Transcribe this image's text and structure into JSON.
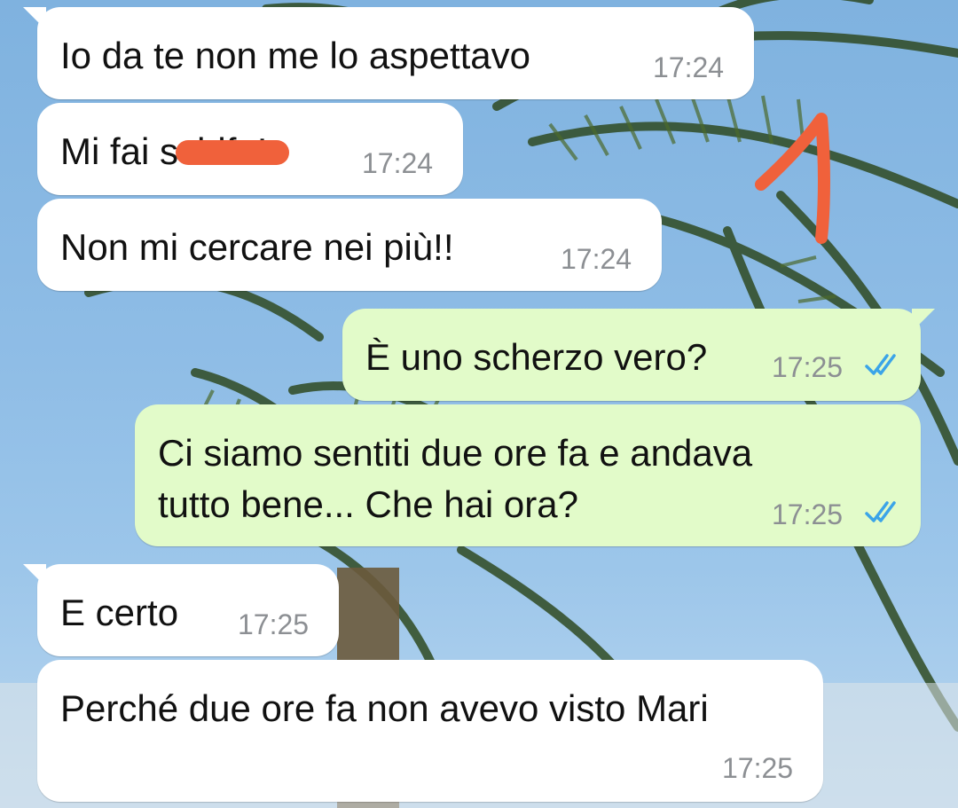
{
  "chat": {
    "messages": [
      {
        "direction": "incoming",
        "text": "Io da te non me lo aspettavo",
        "time": "17:24"
      },
      {
        "direction": "incoming",
        "text": "Mi fai schifo!",
        "time": "17:24",
        "redacted_word": "schifo"
      },
      {
        "direction": "incoming",
        "text": "Non mi cercare nei più!!",
        "time": "17:24"
      },
      {
        "direction": "outgoing",
        "text": "È uno scherzo vero?",
        "time": "17:25",
        "status": "read"
      },
      {
        "direction": "outgoing",
        "text": "Ci siamo sentiti due ore fa e andava\ntutto bene... Che hai ora?",
        "time": "17:25",
        "status": "read"
      },
      {
        "direction": "incoming",
        "text": "E certo",
        "time": "17:25"
      },
      {
        "direction": "incoming",
        "text": "Perché due ore fa non avevo visto Mari",
        "time": "17:25"
      }
    ],
    "visible_text": {
      "msg2_prefix": "Mi fai ",
      "msg2_suffix": "!"
    }
  },
  "annotation": {
    "label": "1",
    "color": "#f0613b"
  },
  "colors": {
    "incoming_bubble": "#ffffff",
    "outgoing_bubble": "#e2fbc9",
    "timestamp": "#8c8f93",
    "read_ticks": "#3ba4e8",
    "redaction": "#f0613b"
  },
  "icons": {
    "read_receipt": "double-check-icon"
  }
}
